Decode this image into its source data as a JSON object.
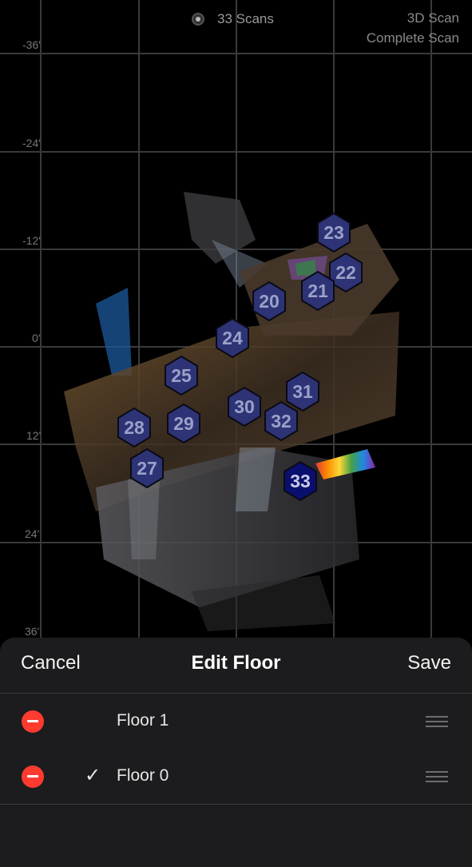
{
  "map": {
    "scans_label": "33 Scans",
    "status": {
      "line1": "3D Scan",
      "line2": "Complete Scan"
    },
    "axis_labels": [
      "-36'",
      "-24'",
      "-12'",
      "0'",
      "12'",
      "24'",
      "36'"
    ],
    "scan_markers": [
      {
        "number": "23",
        "active": false
      },
      {
        "number": "22",
        "active": false
      },
      {
        "number": "21",
        "active": false
      },
      {
        "number": "20",
        "active": false
      },
      {
        "number": "24",
        "active": false
      },
      {
        "number": "25",
        "active": false
      },
      {
        "number": "31",
        "active": false
      },
      {
        "number": "30",
        "active": false
      },
      {
        "number": "32",
        "active": false
      },
      {
        "number": "28",
        "active": false
      },
      {
        "number": "29",
        "active": false
      },
      {
        "number": "27",
        "active": false
      },
      {
        "number": "33",
        "active": true
      }
    ]
  },
  "sheet": {
    "cancel_label": "Cancel",
    "title": "Edit Floor",
    "save_label": "Save",
    "floors": [
      {
        "name": "Floor 1",
        "checked": false
      },
      {
        "name": "Floor 0",
        "checked": true
      }
    ]
  },
  "colors": {
    "background": "#000000",
    "sheet": "#1c1c1e",
    "marker_fill": "#2e3376",
    "marker_active_fill": "#0a0e6e",
    "remove": "#ff3b30"
  }
}
